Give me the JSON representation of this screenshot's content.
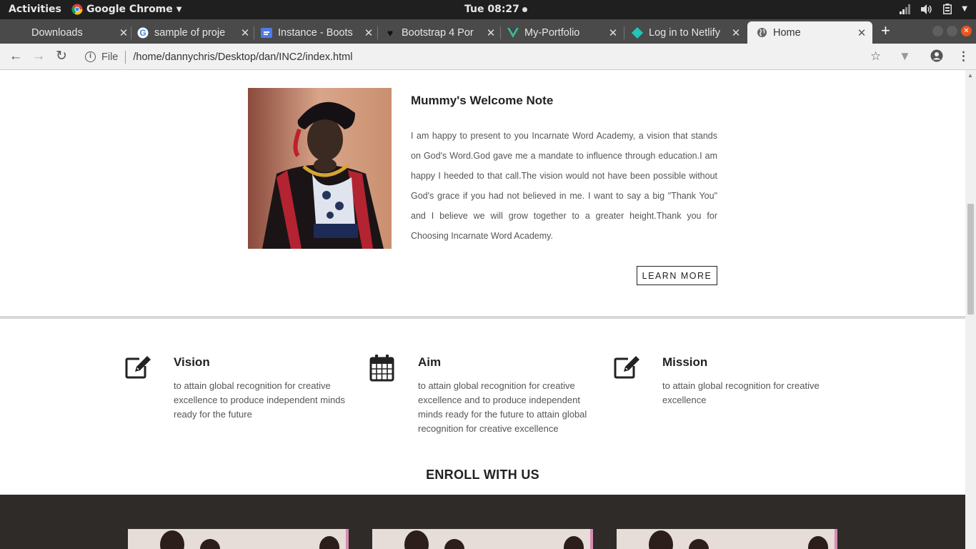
{
  "system": {
    "activities": "Activities",
    "app_name": "Google Chrome",
    "clock": "Tue 08:27"
  },
  "tabs": [
    {
      "title": "Downloads",
      "icon": "download-icon"
    },
    {
      "title": "sample of proje",
      "icon": "google-icon"
    },
    {
      "title": "Instance - Boots",
      "icon": "instance-icon"
    },
    {
      "title": "Bootstrap 4 Por",
      "icon": "heart-icon"
    },
    {
      "title": "My-Portfolio",
      "icon": "vue-icon"
    },
    {
      "title": "Log in to Netlify",
      "icon": "netlify-icon"
    },
    {
      "title": "Home",
      "icon": "globe-icon"
    }
  ],
  "address": {
    "scheme": "File",
    "url": "/home/dannychris/Desktop/dan/INC2/index.html"
  },
  "welcome": {
    "heading": "Mummy's Welcome Note",
    "body": "I am happy to present to you Incarnate Word Academy, a vision that stands on God's Word.God gave me a mandate to influence through education.I am happy I heeded to that call.The vision would not have been possible without God's grace if you had not believed in me. I want to say a big \"Thank You\" and I believe we will grow together to a greater height.Thank you for Choosing Incarnate Word Academy.",
    "button": "LEARN MORE"
  },
  "features": [
    {
      "title": "Vision",
      "icon": "edit-icon",
      "text": "to attain global recognition for creative excellence to produce independent minds ready for the future"
    },
    {
      "title": "Aim",
      "icon": "calendar-icon",
      "text": "to attain global recognition for creative excellence and to produce independent minds ready for the future to attain global recognition for creative excellence"
    },
    {
      "title": "Mission",
      "icon": "edit-icon",
      "text": "to attain global recognition for creative excellence"
    }
  ],
  "enroll": {
    "heading": "ENROLL WITH US"
  },
  "colors": {
    "topbar": "#1f1f1f",
    "tabstrip": "#4a4a4a",
    "enroll_band": "#2e2b29"
  }
}
